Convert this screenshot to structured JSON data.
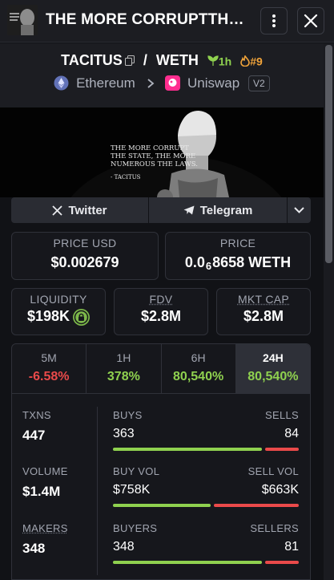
{
  "header": {
    "title": "THE MORE CORRUPTTHE STATE",
    "more_icon": "more-vertical-icon",
    "close_icon": "close-icon"
  },
  "pair": {
    "base": "TACITUS",
    "separator": "/",
    "quote": "WETH",
    "age": "1h",
    "rank": "#9",
    "chain": "Ethereum",
    "dex": "Uniswap",
    "version": "V2"
  },
  "banner": {
    "lines": [
      "THE MORE CORRUPT",
      "THE STATE, THE MORE",
      "NUMEROUS THE LAWS."
    ],
    "author": "- TACITUS"
  },
  "social": {
    "twitter": "Twitter",
    "telegram": "Telegram"
  },
  "prices": {
    "usd_label": "PRICE USD",
    "usd_value": "$0.002679",
    "native_label": "PRICE",
    "native_prefix": "0.0",
    "native_zeros": "6",
    "native_digits": "8658 WETH"
  },
  "metrics": {
    "liquidity_label": "LIQUIDITY",
    "liquidity_value": "$198K",
    "fdv_label": "FDV",
    "fdv_value": "$2.8M",
    "mcap_label": "MKT CAP",
    "mcap_value": "$2.8M"
  },
  "tabs": [
    {
      "label": "5M",
      "value": "-6.58%"
    },
    {
      "label": "1H",
      "value": "378%"
    },
    {
      "label": "6H",
      "value": "80,540%"
    },
    {
      "label": "24H",
      "value": "80,540%"
    }
  ],
  "stats": {
    "txns_label": "TXNS",
    "txns_value": "447",
    "buys_label": "BUYS",
    "buys_value": "363",
    "sells_label": "SELLS",
    "sells_value": "84",
    "buys_fraction": 0.812,
    "volume_label": "VOLUME",
    "volume_value": "$1.4M",
    "buyvol_label": "BUY VOL",
    "buyvol_value": "$758K",
    "sellvol_label": "SELL VOL",
    "sellvol_value": "$663K",
    "buyvol_fraction": 0.533,
    "makers_label": "MAKERS",
    "makers_value": "348",
    "buyers_label": "BUYERS",
    "buyers_value": "348",
    "sellers_label": "SELLERS",
    "sellers_value": "81",
    "buyers_fraction": 0.811
  },
  "colors": {
    "positive": "#8fd14f",
    "negative": "#ea4a4a",
    "rank": "#f0a33a"
  }
}
